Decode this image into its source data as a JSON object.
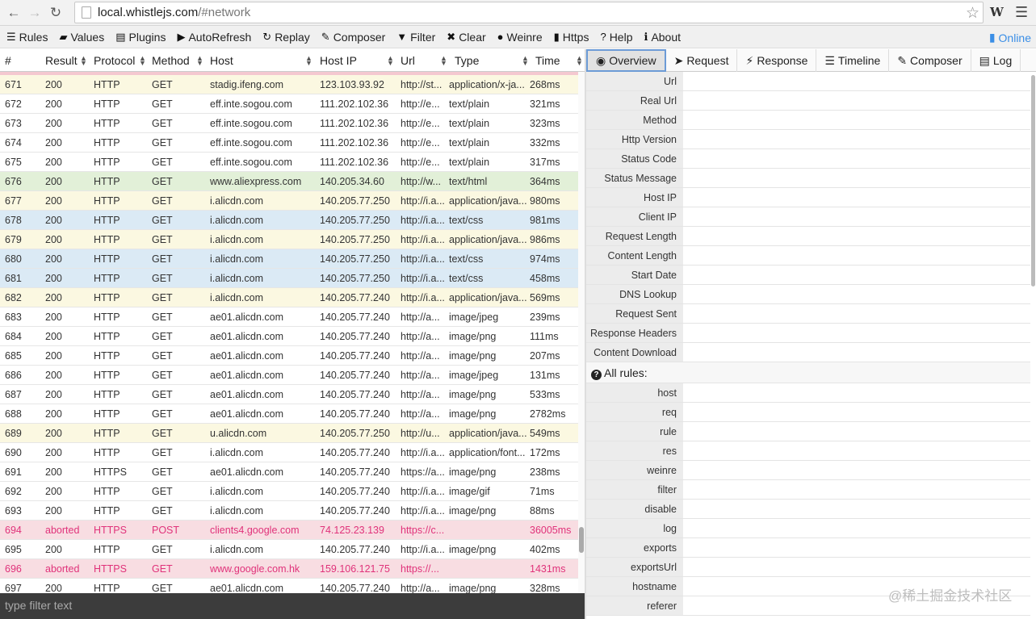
{
  "browser": {
    "url_host": "local.whistlejs.com",
    "url_rest": "/#network"
  },
  "toolbar": {
    "items": [
      {
        "label": "Rules",
        "icon": "list-icon",
        "glyph": "☰"
      },
      {
        "label": "Values",
        "icon": "folder-icon",
        "glyph": "▰"
      },
      {
        "label": "Plugins",
        "icon": "plugin-icon",
        "glyph": "▤"
      },
      {
        "label": "AutoRefresh",
        "icon": "play-icon",
        "glyph": "▶"
      },
      {
        "label": "Replay",
        "icon": "refresh-icon",
        "glyph": "↻"
      },
      {
        "label": "Composer",
        "icon": "edit-icon",
        "glyph": "✎"
      },
      {
        "label": "Filter",
        "icon": "filter-icon",
        "glyph": "▼"
      },
      {
        "label": "Clear",
        "icon": "close-icon",
        "glyph": "✖"
      },
      {
        "label": "Weinre",
        "icon": "globe-icon",
        "glyph": "●"
      },
      {
        "label": "Https",
        "icon": "lock-icon",
        "glyph": "▮"
      },
      {
        "label": "Help",
        "icon": "question-icon",
        "glyph": "?"
      },
      {
        "label": "About",
        "icon": "info-icon",
        "glyph": "ℹ"
      }
    ],
    "online_label": "Online"
  },
  "network": {
    "columns": {
      "num": "#",
      "result": "Result",
      "protocol": "Protocol",
      "method": "Method",
      "host": "Host",
      "host_ip": "Host IP",
      "url": "Url",
      "type": "Type",
      "time": "Time"
    },
    "rows": [
      {
        "num": "671",
        "result": "200",
        "protocol": "HTTP",
        "method": "GET",
        "host": "stadig.ifeng.com",
        "ip": "123.103.93.92",
        "url": "http://st...",
        "type": "application/x-ja...",
        "time": "268ms",
        "style": "yellow"
      },
      {
        "num": "672",
        "result": "200",
        "protocol": "HTTP",
        "method": "GET",
        "host": "eff.inte.sogou.com",
        "ip": "111.202.102.36",
        "url": "http://e...",
        "type": "text/plain",
        "time": "321ms",
        "style": "white"
      },
      {
        "num": "673",
        "result": "200",
        "protocol": "HTTP",
        "method": "GET",
        "host": "eff.inte.sogou.com",
        "ip": "111.202.102.36",
        "url": "http://e...",
        "type": "text/plain",
        "time": "323ms",
        "style": "white"
      },
      {
        "num": "674",
        "result": "200",
        "protocol": "HTTP",
        "method": "GET",
        "host": "eff.inte.sogou.com",
        "ip": "111.202.102.36",
        "url": "http://e...",
        "type": "text/plain",
        "time": "332ms",
        "style": "white"
      },
      {
        "num": "675",
        "result": "200",
        "protocol": "HTTP",
        "method": "GET",
        "host": "eff.inte.sogou.com",
        "ip": "111.202.102.36",
        "url": "http://e...",
        "type": "text/plain",
        "time": "317ms",
        "style": "white"
      },
      {
        "num": "676",
        "result": "200",
        "protocol": "HTTP",
        "method": "GET",
        "host": "www.aliexpress.com",
        "ip": "140.205.34.60",
        "url": "http://w...",
        "type": "text/html",
        "time": "364ms",
        "style": "green"
      },
      {
        "num": "677",
        "result": "200",
        "protocol": "HTTP",
        "method": "GET",
        "host": "i.alicdn.com",
        "ip": "140.205.77.250",
        "url": "http://i.a...",
        "type": "application/java...",
        "time": "980ms",
        "style": "yellow"
      },
      {
        "num": "678",
        "result": "200",
        "protocol": "HTTP",
        "method": "GET",
        "host": "i.alicdn.com",
        "ip": "140.205.77.250",
        "url": "http://i.a...",
        "type": "text/css",
        "time": "981ms",
        "style": "blue"
      },
      {
        "num": "679",
        "result": "200",
        "protocol": "HTTP",
        "method": "GET",
        "host": "i.alicdn.com",
        "ip": "140.205.77.250",
        "url": "http://i.a...",
        "type": "application/java...",
        "time": "986ms",
        "style": "yellow"
      },
      {
        "num": "680",
        "result": "200",
        "protocol": "HTTP",
        "method": "GET",
        "host": "i.alicdn.com",
        "ip": "140.205.77.250",
        "url": "http://i.a...",
        "type": "text/css",
        "time": "974ms",
        "style": "blue"
      },
      {
        "num": "681",
        "result": "200",
        "protocol": "HTTP",
        "method": "GET",
        "host": "i.alicdn.com",
        "ip": "140.205.77.250",
        "url": "http://i.a...",
        "type": "text/css",
        "time": "458ms",
        "style": "blue"
      },
      {
        "num": "682",
        "result": "200",
        "protocol": "HTTP",
        "method": "GET",
        "host": "i.alicdn.com",
        "ip": "140.205.77.240",
        "url": "http://i.a...",
        "type": "application/java...",
        "time": "569ms",
        "style": "yellow"
      },
      {
        "num": "683",
        "result": "200",
        "protocol": "HTTP",
        "method": "GET",
        "host": "ae01.alicdn.com",
        "ip": "140.205.77.240",
        "url": "http://a...",
        "type": "image/jpeg",
        "time": "239ms",
        "style": "white"
      },
      {
        "num": "684",
        "result": "200",
        "protocol": "HTTP",
        "method": "GET",
        "host": "ae01.alicdn.com",
        "ip": "140.205.77.240",
        "url": "http://a...",
        "type": "image/png",
        "time": "111ms",
        "style": "white"
      },
      {
        "num": "685",
        "result": "200",
        "protocol": "HTTP",
        "method": "GET",
        "host": "ae01.alicdn.com",
        "ip": "140.205.77.240",
        "url": "http://a...",
        "type": "image/png",
        "time": "207ms",
        "style": "white"
      },
      {
        "num": "686",
        "result": "200",
        "protocol": "HTTP",
        "method": "GET",
        "host": "ae01.alicdn.com",
        "ip": "140.205.77.240",
        "url": "http://a...",
        "type": "image/jpeg",
        "time": "131ms",
        "style": "white"
      },
      {
        "num": "687",
        "result": "200",
        "protocol": "HTTP",
        "method": "GET",
        "host": "ae01.alicdn.com",
        "ip": "140.205.77.240",
        "url": "http://a...",
        "type": "image/png",
        "time": "533ms",
        "style": "white"
      },
      {
        "num": "688",
        "result": "200",
        "protocol": "HTTP",
        "method": "GET",
        "host": "ae01.alicdn.com",
        "ip": "140.205.77.240",
        "url": "http://a...",
        "type": "image/png",
        "time": "2782ms",
        "style": "white"
      },
      {
        "num": "689",
        "result": "200",
        "protocol": "HTTP",
        "method": "GET",
        "host": "u.alicdn.com",
        "ip": "140.205.77.250",
        "url": "http://u...",
        "type": "application/java...",
        "time": "549ms",
        "style": "yellow"
      },
      {
        "num": "690",
        "result": "200",
        "protocol": "HTTP",
        "method": "GET",
        "host": "i.alicdn.com",
        "ip": "140.205.77.240",
        "url": "http://i.a...",
        "type": "application/font...",
        "time": "172ms",
        "style": "white"
      },
      {
        "num": "691",
        "result": "200",
        "protocol": "HTTPS",
        "method": "GET",
        "host": "ae01.alicdn.com",
        "ip": "140.205.77.240",
        "url": "https://a...",
        "type": "image/png",
        "time": "238ms",
        "style": "white"
      },
      {
        "num": "692",
        "result": "200",
        "protocol": "HTTP",
        "method": "GET",
        "host": "i.alicdn.com",
        "ip": "140.205.77.240",
        "url": "http://i.a...",
        "type": "image/gif",
        "time": "71ms",
        "style": "white"
      },
      {
        "num": "693",
        "result": "200",
        "protocol": "HTTP",
        "method": "GET",
        "host": "i.alicdn.com",
        "ip": "140.205.77.240",
        "url": "http://i.a...",
        "type": "image/png",
        "time": "88ms",
        "style": "white"
      },
      {
        "num": "694",
        "result": "aborted",
        "protocol": "HTTPS",
        "method": "POST",
        "host": "clients4.google.com",
        "ip": "74.125.23.139",
        "url": "https://c...",
        "type": "",
        "time": "36005ms",
        "style": "error"
      },
      {
        "num": "695",
        "result": "200",
        "protocol": "HTTP",
        "method": "GET",
        "host": "i.alicdn.com",
        "ip": "140.205.77.240",
        "url": "http://i.a...",
        "type": "image/png",
        "time": "402ms",
        "style": "white"
      },
      {
        "num": "696",
        "result": "aborted",
        "protocol": "HTTPS",
        "method": "GET",
        "host": "www.google.com.hk",
        "ip": "159.106.121.75",
        "url": "https://...",
        "type": "",
        "time": "1431ms",
        "style": "error"
      },
      {
        "num": "697",
        "result": "200",
        "protocol": "HTTP",
        "method": "GET",
        "host": "ae01.alicdn.com",
        "ip": "140.205.77.240",
        "url": "http://a...",
        "type": "image/png",
        "time": "328ms",
        "style": "white"
      }
    ],
    "filter_placeholder": "type filter text"
  },
  "detail": {
    "tabs": [
      {
        "label": "Overview",
        "glyph": "◉",
        "icon": "eye-icon",
        "active": true
      },
      {
        "label": "Request",
        "glyph": "➤",
        "icon": "send-icon",
        "active": false
      },
      {
        "label": "Response",
        "glyph": "⚡",
        "icon": "bolt-icon",
        "active": false
      },
      {
        "label": "Timeline",
        "glyph": "☰",
        "icon": "timeline-icon",
        "active": false
      },
      {
        "label": "Composer",
        "glyph": "✎",
        "icon": "edit-icon",
        "active": false
      },
      {
        "label": "Log",
        "glyph": "▤",
        "icon": "file-icon",
        "active": false
      }
    ],
    "overview_fields": [
      "Url",
      "Real Url",
      "Method",
      "Http Version",
      "Status Code",
      "Status Message",
      "Host IP",
      "Client IP",
      "Request Length",
      "Content Length",
      "Start Date",
      "DNS Lookup",
      "Request Sent",
      "Response Headers",
      "Content Download"
    ],
    "rules_title": "All rules:",
    "rule_fields": [
      "host",
      "req",
      "rule",
      "res",
      "weinre",
      "filter",
      "disable",
      "log",
      "exports",
      "exportsUrl",
      "hostname",
      "referer"
    ]
  },
  "watermark": "@稀土掘金技术社区"
}
